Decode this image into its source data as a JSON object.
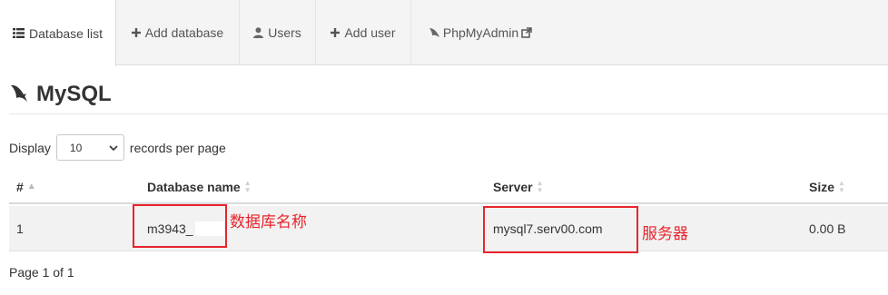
{
  "tabs": [
    {
      "label": "Database list",
      "icon": "list-icon",
      "active": true
    },
    {
      "label": "Add database",
      "icon": "plus-icon",
      "active": false
    },
    {
      "label": "Users",
      "icon": "user-icon",
      "active": false
    },
    {
      "label": "Add user",
      "icon": "plus-icon",
      "active": false
    },
    {
      "label": "PhpMyAdmin",
      "icon": "dolphin-icon",
      "external_icon": "external-link-icon",
      "active": false
    }
  ],
  "section": {
    "title": "MySQL",
    "icon": "mysql-dolphin-icon"
  },
  "length_control": {
    "prefix": "Display",
    "selected": "10",
    "suffix": "records per page"
  },
  "table": {
    "columns": [
      "#",
      "Database name",
      "Server",
      "Size"
    ],
    "rows": [
      {
        "index": "1",
        "database_name": "m3943_",
        "server": "mysql7.serv00.com",
        "size": "0.00 B"
      }
    ]
  },
  "annotations": {
    "database_name": "数据库名称",
    "server": "服务器"
  },
  "pagination": {
    "text": "Page 1 of 1"
  },
  "colors": {
    "annotation": "#e8242c",
    "tab_bar": "#f4f4f4",
    "row_bg": "#f2f2f2"
  }
}
